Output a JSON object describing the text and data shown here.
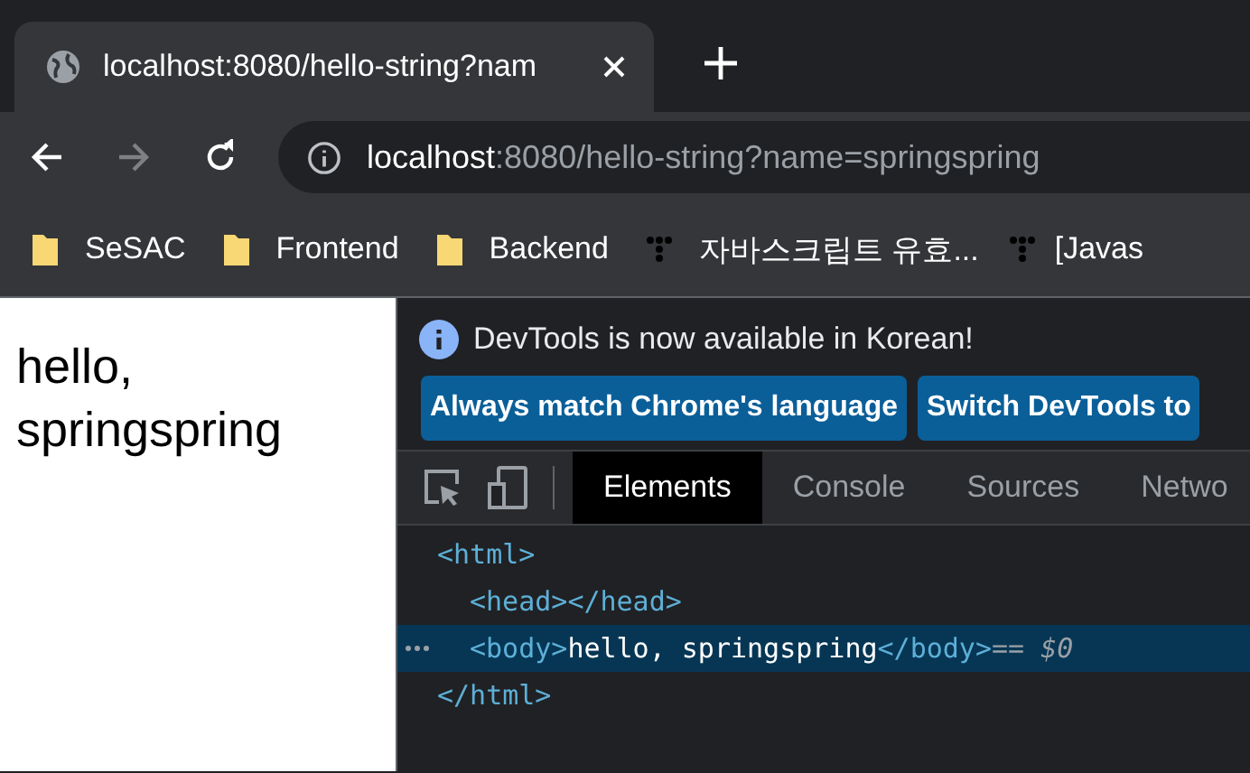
{
  "browser_tab": {
    "title": "localhost:8080/hello-string?nam",
    "selected": true
  },
  "navigation": {
    "back_disabled": false,
    "forward_disabled": true
  },
  "address": {
    "host": "localhost",
    "rest": ":8080/hello-string?name=springspring"
  },
  "bookmarks": [
    {
      "kind": "folder",
      "label": "SeSAC"
    },
    {
      "kind": "folder",
      "label": "Frontend"
    },
    {
      "kind": "folder",
      "label": "Backend"
    },
    {
      "kind": "page",
      "label": "자바스크립트 유효..."
    },
    {
      "kind": "page",
      "label": "[Javas"
    }
  ],
  "page": {
    "text": "hello, springspring"
  },
  "devtools": {
    "notice": "DevTools is now available in Korean!",
    "buttons": [
      "Always match Chrome's language",
      "Switch DevTools to"
    ],
    "tabs": [
      {
        "label": "Elements",
        "selected": true
      },
      {
        "label": "Console",
        "selected": false
      },
      {
        "label": "Sources",
        "selected": false
      },
      {
        "label": "Netwo",
        "selected": false
      }
    ],
    "dom_tree": [
      {
        "open": "<html>",
        "close": "</html>",
        "selected": false,
        "children": [
          {
            "open": "<head>",
            "inline_close": "</head>",
            "selected": false
          },
          {
            "open": "<body>",
            "text": "hello, springspring",
            "inline_close": "</body>",
            "note": "== $0",
            "selected": true
          }
        ]
      }
    ]
  }
}
